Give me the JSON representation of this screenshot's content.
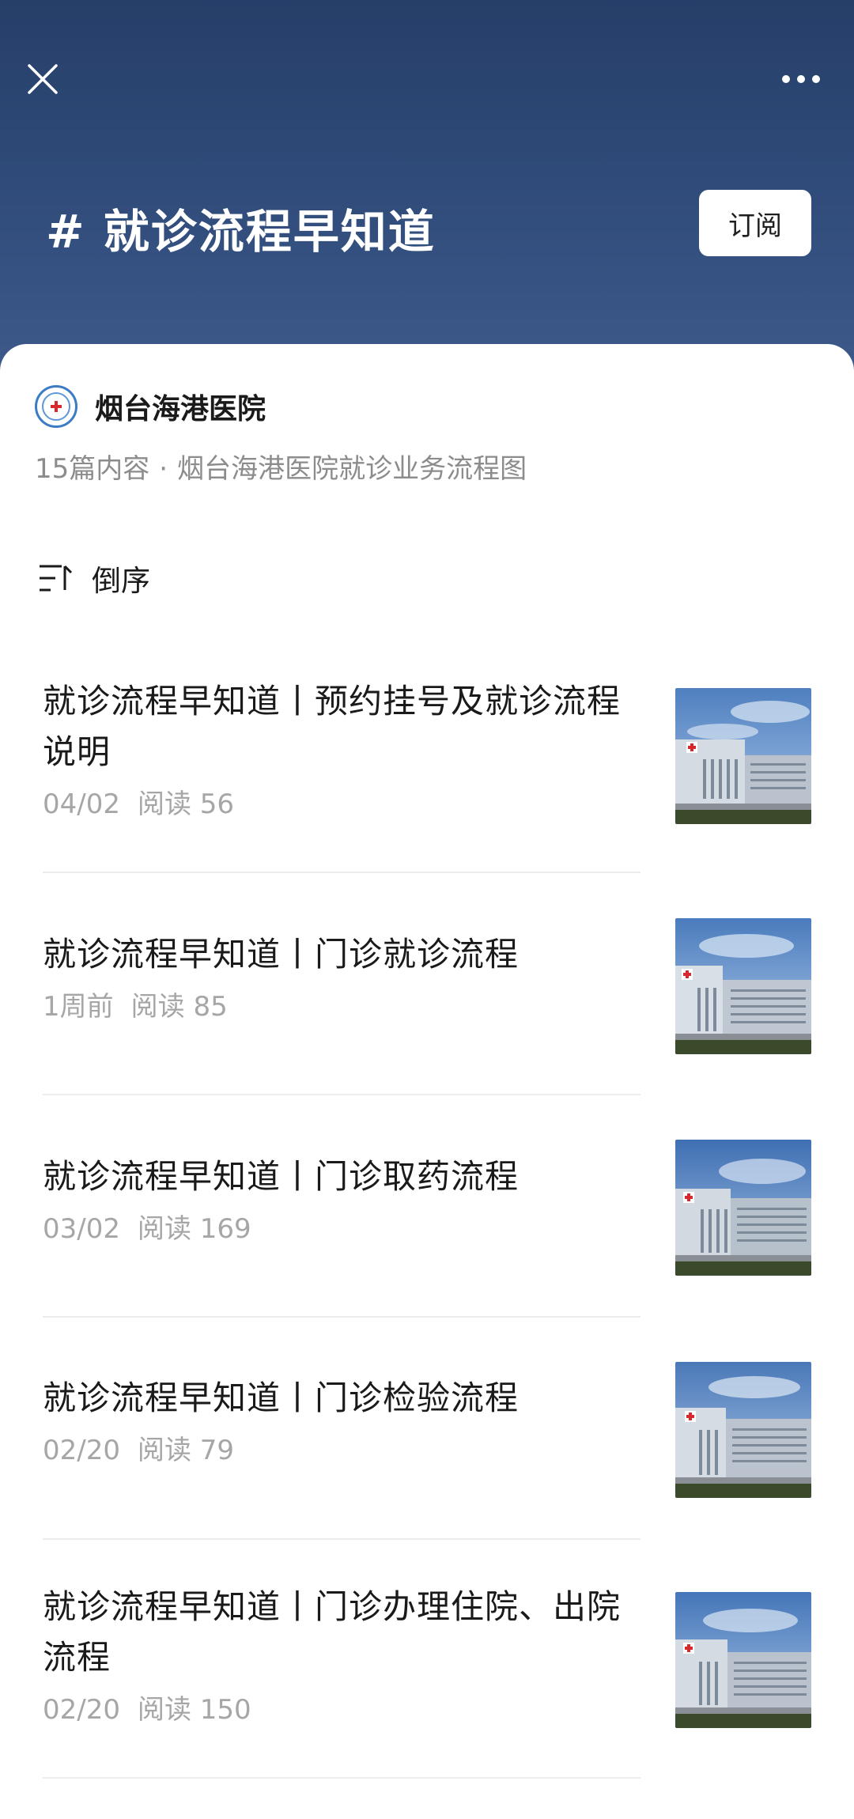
{
  "header": {
    "close_icon": "close-icon",
    "more_icon": "more-icon",
    "topic_title": "# 就诊流程早知道",
    "subscribe_label": "订阅"
  },
  "account": {
    "name": "烟台海港医院",
    "count_text": "15篇内容",
    "separator": "·",
    "description": "烟台海港医院就诊业务流程图"
  },
  "sort": {
    "icon": "sort-descending-icon",
    "label": "倒序"
  },
  "articles": [
    {
      "title": "就诊流程早知道丨预约挂号及就诊流程说明",
      "date": "04/02",
      "reads": "阅读 56"
    },
    {
      "title": "就诊流程早知道丨门诊就诊流程",
      "date": "1周前",
      "reads": "阅读 85"
    },
    {
      "title": "就诊流程早知道丨门诊取药流程",
      "date": "03/02",
      "reads": "阅读 169"
    },
    {
      "title": "就诊流程早知道丨门诊检验流程",
      "date": "02/20",
      "reads": "阅读 79"
    },
    {
      "title": "就诊流程早知道丨门诊办理住院、出院流程",
      "date": "02/20",
      "reads": "阅读 150"
    }
  ],
  "colors": {
    "header_top": "#263f69",
    "header_bottom": "#3d5a8c",
    "meta_text": "#a6a6a6"
  }
}
